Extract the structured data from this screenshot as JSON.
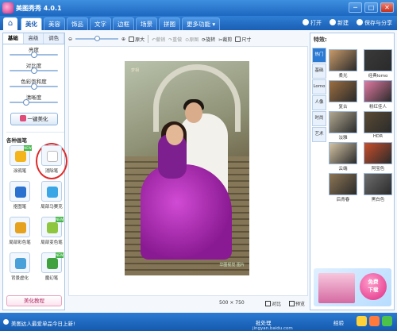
{
  "window": {
    "title": "美图秀秀 4.0.1",
    "controls": [
      "─",
      "□",
      "✕"
    ]
  },
  "nav": {
    "tabs": [
      "美化",
      "美容",
      "饰品",
      "文字",
      "边框",
      "场景",
      "拼图",
      "更多功能 ▾"
    ],
    "active_tab": "美化",
    "right": {
      "open": "打开",
      "new": "新建",
      "save": "保存与分享"
    }
  },
  "left_panel": {
    "subtabs": [
      "基础",
      "高级",
      "调色"
    ],
    "sliders": [
      {
        "label": "亮度",
        "level": 0.5
      },
      {
        "label": "对比度",
        "level": 0.5
      },
      {
        "label": "色彩饱和度",
        "level": 0.5
      },
      {
        "label": "清晰度",
        "level": 0.35
      }
    ],
    "one_click": "一键美化",
    "pens_title": "各种画笔",
    "pens": [
      {
        "label": "涂鸦笔",
        "icon": "doodle-pen-icon",
        "color": "#f3b51b",
        "new": true
      },
      {
        "label": "消除笔",
        "icon": "eraser-pen-icon",
        "color": "#ffffff",
        "new": false,
        "highlighted": true
      },
      {
        "label": "抠图笔",
        "icon": "cutout-pen-icon",
        "color": "#2a71d0",
        "new": false
      },
      {
        "label": "局部马赛克",
        "icon": "mosaic-icon",
        "color": "#3aa6e6",
        "new": false
      },
      {
        "label": "局部彩色笔",
        "icon": "color-pen-icon",
        "color": "#e6a21e",
        "new": false
      },
      {
        "label": "局部变色笔",
        "icon": "recolor-pen-icon",
        "color": "#8ec63f",
        "new": true
      },
      {
        "label": "背景虚化",
        "icon": "blur-bg-icon",
        "color": "#4aa0d8",
        "new": false
      },
      {
        "label": "魔幻笔",
        "icon": "magic-pen-icon",
        "color": "#3fa23f",
        "new": true
      }
    ],
    "tutorial": "美化教程",
    "new_badge": "NEW"
  },
  "toolbar": {
    "zoom_level": 0.45,
    "original": "原大",
    "undo": "撤销",
    "redo": "重做",
    "revert": "原图",
    "rotate": "旋转",
    "crop": "裁剪",
    "resize": "尺寸"
  },
  "canvas": {
    "photo_caption": "梦相",
    "watermark": "华图视觉 图片"
  },
  "status": {
    "size": "500 × 750",
    "compare": "对比",
    "preview": "预览"
  },
  "right_panel": {
    "header": "特效:",
    "categories": [
      "热门",
      "基础",
      "Lomo",
      "人像",
      "时尚",
      "艺术"
    ],
    "active_category": "热门",
    "effects": [
      {
        "label": "柔光",
        "color": "#c79a6a"
      },
      {
        "label": "经典lomo",
        "color": "#3a3a3a"
      },
      {
        "label": "复古",
        "color": "#9c6e40"
      },
      {
        "label": "粉红佳人",
        "color": "#e07aa2"
      },
      {
        "label": "淡雅",
        "color": "#b2a992"
      },
      {
        "label": "HDR",
        "color": "#5b4b34"
      },
      {
        "label": "云端",
        "color": "#d5c4a5"
      },
      {
        "label": "阿宝色",
        "color": "#c94f2a"
      },
      {
        "label": "后青春",
        "color": "#8d7655"
      },
      {
        "label": "黑白色",
        "color": "#6e6e6e"
      }
    ],
    "ad_button": "免费\n下载"
  },
  "taskbar": {
    "news": "美图达人最爱单品今日上新!",
    "batch": "批处理",
    "site": "jingyan.baidu.com",
    "extra": "经验"
  }
}
